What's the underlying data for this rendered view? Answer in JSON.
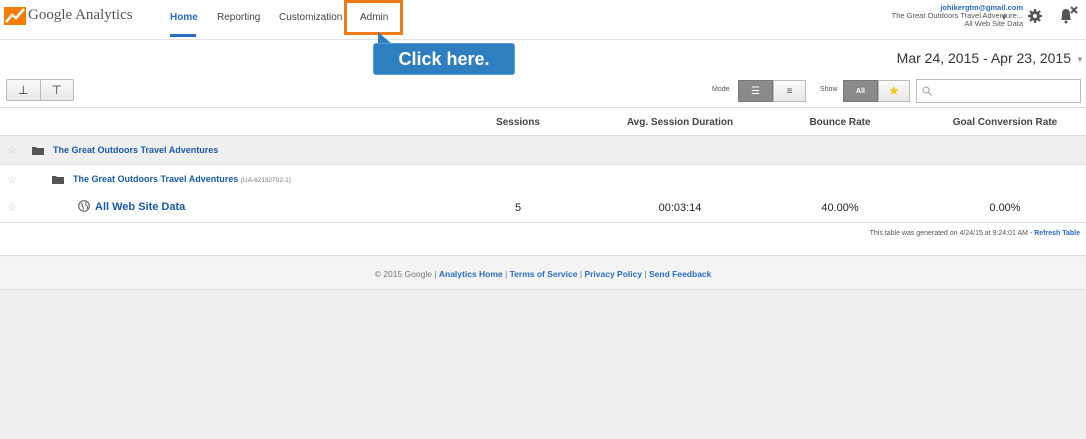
{
  "header": {
    "logo_text": "Google Analytics",
    "nav": {
      "home": "Home",
      "reporting": "Reporting",
      "customization": "Customization",
      "admin": "Admin"
    },
    "account": {
      "email": "johikergtm@gmail.com",
      "account_name": "The Great Outdoors Travel Adventure...",
      "view": "All Web Site Data"
    },
    "accent_color": "#2a6cbf",
    "highlight_color": "#f07b1d"
  },
  "callout": {
    "text": "Click here."
  },
  "date_range": "Mar 24, 2015 - Apr 23, 2015",
  "toolbar": {
    "mode_label": "Mode",
    "show_label": "Show",
    "show_all": "All",
    "search_placeholder": ""
  },
  "table": {
    "columns": [
      "Sessions",
      "Avg. Session Duration",
      "Bounce Rate",
      "Goal Conversion Rate"
    ],
    "rows": [
      {
        "label": "The Great Outdoors Travel Adventures"
      },
      {
        "label": "The Great Outdoors Travel Adventures",
        "sub": "(UA-62192702-1)"
      },
      {
        "label": "All Web Site Data",
        "sessions": "5",
        "avg_duration": "00:03:14",
        "bounce_rate": "40.00%",
        "goal_conversion": "0.00%"
      }
    ],
    "generated_note": "This table was generated on 4/24/15 at 9:24:01 AM - ",
    "refresh_label": "Refresh Table"
  },
  "footer": {
    "copyright": "© 2015 Google | ",
    "links": [
      "Analytics Home",
      "Terms of Service",
      "Privacy Policy",
      "Send Feedback"
    ],
    "separator": " | "
  }
}
